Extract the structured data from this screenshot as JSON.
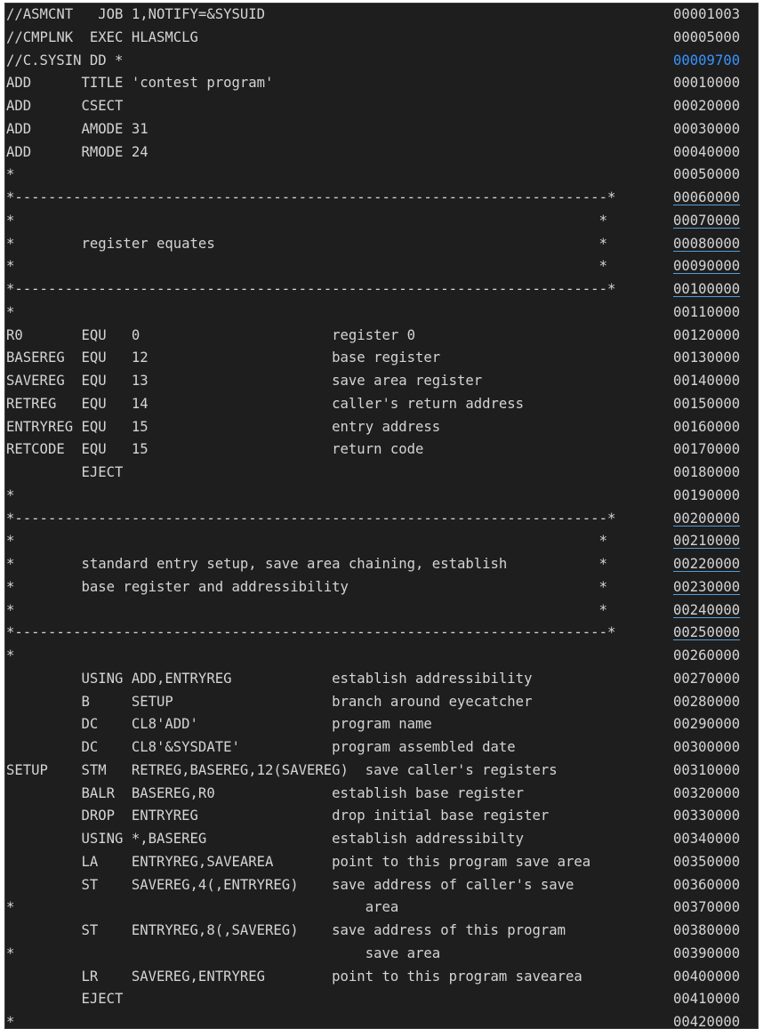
{
  "editor": {
    "lines": [
      {
        "code": "//ASMCNT   JOB 1,NOTIFY=&SYSUID",
        "seq": "00001003"
      },
      {
        "code": "//CMPLNK  EXEC HLASMCLG",
        "seq": "00005000"
      },
      {
        "code": "//C.SYSIN DD *",
        "seq": "00009700"
      },
      {
        "code": "ADD      TITLE 'contest program'",
        "seq": "00010000"
      },
      {
        "code": "ADD      CSECT",
        "seq": "00020000"
      },
      {
        "code": "ADD      AMODE 31",
        "seq": "00030000"
      },
      {
        "code": "ADD      RMODE 24",
        "seq": "00040000"
      },
      {
        "code": "*",
        "seq": "00050000"
      },
      {
        "code": "*-----------------------------------------------------------------------*",
        "seq": "00060000"
      },
      {
        "code": "*                                                                      *",
        "seq": "00070000"
      },
      {
        "code": "*        register equates                                              *",
        "seq": "00080000"
      },
      {
        "code": "*                                                                      *",
        "seq": "00090000"
      },
      {
        "code": "*-----------------------------------------------------------------------*",
        "seq": "00100000"
      },
      {
        "code": "*",
        "seq": "00110000"
      },
      {
        "code": "R0       EQU   0                       register 0",
        "seq": "00120000"
      },
      {
        "code": "BASEREG  EQU   12                      base register",
        "seq": "00130000"
      },
      {
        "code": "SAVEREG  EQU   13                      save area register",
        "seq": "00140000"
      },
      {
        "code": "RETREG   EQU   14                      caller's return address",
        "seq": "00150000"
      },
      {
        "code": "ENTRYREG EQU   15                      entry address",
        "seq": "00160000"
      },
      {
        "code": "RETCODE  EQU   15                      return code",
        "seq": "00170000"
      },
      {
        "code": "         EJECT",
        "seq": "00180000"
      },
      {
        "code": "*",
        "seq": "00190000"
      },
      {
        "code": "*-----------------------------------------------------------------------*",
        "seq": "00200000"
      },
      {
        "code": "*                                                                      *",
        "seq": "00210000"
      },
      {
        "code": "*        standard entry setup, save area chaining, establish           *",
        "seq": "00220000"
      },
      {
        "code": "*        base register and addressibility                              *",
        "seq": "00230000"
      },
      {
        "code": "*                                                                      *",
        "seq": "00240000"
      },
      {
        "code": "*-----------------------------------------------------------------------*",
        "seq": "00250000"
      },
      {
        "code": "*",
        "seq": "00260000"
      },
      {
        "code": "         USING ADD,ENTRYREG            establish addressibility",
        "seq": "00270000"
      },
      {
        "code": "         B     SETUP                   branch around eyecatcher",
        "seq": "00280000"
      },
      {
        "code": "         DC    CL8'ADD'                program name",
        "seq": "00290000"
      },
      {
        "code": "         DC    CL8'&SYSDATE'           program assembled date",
        "seq": "00300000"
      },
      {
        "code": "SETUP    STM   RETREG,BASEREG,12(SAVEREG)  save caller's registers",
        "seq": "00310000"
      },
      {
        "code": "         BALR  BASEREG,R0              establish base register",
        "seq": "00320000"
      },
      {
        "code": "         DROP  ENTRYREG                drop initial base register",
        "seq": "00330000"
      },
      {
        "code": "         USING *,BASEREG               establish addressibilty",
        "seq": "00340000"
      },
      {
        "code": "         LA    ENTRYREG,SAVEAREA       point to this program save area",
        "seq": "00350000"
      },
      {
        "code": "         ST    SAVEREG,4(,ENTRYREG)    save address of caller's save",
        "seq": "00360000"
      },
      {
        "code": "*                                          area",
        "seq": "00370000"
      },
      {
        "code": "         ST    ENTRYREG,8(,SAVEREG)    save address of this program",
        "seq": "00380000"
      },
      {
        "code": "*                                          save area",
        "seq": "00390000"
      },
      {
        "code": "         LR    SAVEREG,ENTRYREG        point to this program savearea",
        "seq": "00400000"
      },
      {
        "code": "         EJECT",
        "seq": "00410000"
      },
      {
        "code": "*",
        "seq": "00420000"
      }
    ]
  }
}
